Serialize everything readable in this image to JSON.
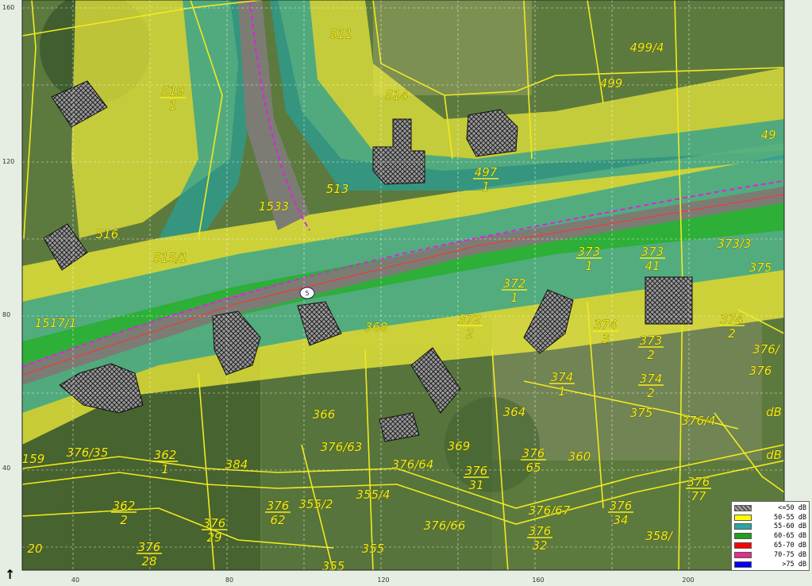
{
  "map": {
    "x_ticks": [
      "40",
      "80",
      "120",
      "160",
      "200"
    ],
    "y_ticks": [
      "160",
      "120",
      "80",
      "40"
    ],
    "receiver_marker": "5",
    "parcels": [
      {
        "n": "511"
      },
      {
        "n": "519",
        "d": "1"
      },
      {
        "n": "514"
      },
      {
        "n": "499/4"
      },
      {
        "n": "499"
      },
      {
        "n": "49"
      },
      {
        "n": "497",
        "d": "1"
      },
      {
        "n": "513"
      },
      {
        "n": "1533"
      },
      {
        "n": "516"
      },
      {
        "n": "515/1"
      },
      {
        "n": "373",
        "d": "1"
      },
      {
        "n": "373",
        "d": "41"
      },
      {
        "n": "373/3"
      },
      {
        "n": "375"
      },
      {
        "n": "372",
        "d": "1"
      },
      {
        "n": "1517/1"
      },
      {
        "n": "368"
      },
      {
        "n": "372",
        "d": "2"
      },
      {
        "n": "374",
        "d": "3"
      },
      {
        "n": "373",
        "d": "2"
      },
      {
        "n": "374",
        "d": "2"
      },
      {
        "n": "374",
        "d": "1"
      },
      {
        "n": "374",
        "d": "2"
      },
      {
        "n": "375"
      },
      {
        "n": "376/4"
      },
      {
        "n": "376"
      },
      {
        "n": "366"
      },
      {
        "n": "369"
      },
      {
        "n": "364"
      },
      {
        "n": "360"
      },
      {
        "n": "362",
        "d": "1"
      },
      {
        "n": "376/35"
      },
      {
        "n": "384"
      },
      {
        "n": "376/63"
      },
      {
        "n": "376/64"
      },
      {
        "n": "376",
        "d": "31"
      },
      {
        "n": "376",
        "d": "65"
      },
      {
        "n": "376",
        "d": "77"
      },
      {
        "n": "376",
        "d": "34"
      },
      {
        "n": "362",
        "d": "2"
      },
      {
        "n": "376",
        "d": "62"
      },
      {
        "n": "376",
        "d": "29"
      },
      {
        "n": "355/2"
      },
      {
        "n": "355/4"
      },
      {
        "n": "376/66"
      },
      {
        "n": "376/67"
      },
      {
        "n": "376",
        "d": "32"
      },
      {
        "n": "376",
        "d": "28"
      },
      {
        "n": "355"
      },
      {
        "n": "355"
      },
      {
        "n": "20"
      },
      {
        "n": "159"
      },
      {
        "n": "358/"
      },
      {
        "n": "376/"
      },
      {
        "n": "dB"
      },
      {
        "n": "dB"
      }
    ]
  },
  "legend": {
    "items": [
      {
        "label": "<=50 dB",
        "color": "#808080"
      },
      {
        "label": "50-55 dB",
        "color": "#ffff00"
      },
      {
        "label": "55-60 dB",
        "color": "#2aa7a0"
      },
      {
        "label": "60-65 dB",
        "color": "#1ea01e"
      },
      {
        "label": "65-70 dB",
        "color": "#ff0000"
      },
      {
        "label": "70-75 dB",
        "color": "#e0308a"
      },
      {
        "label": ">75 dB",
        "color": "#0000ff"
      }
    ]
  },
  "north_arrow": "↑"
}
